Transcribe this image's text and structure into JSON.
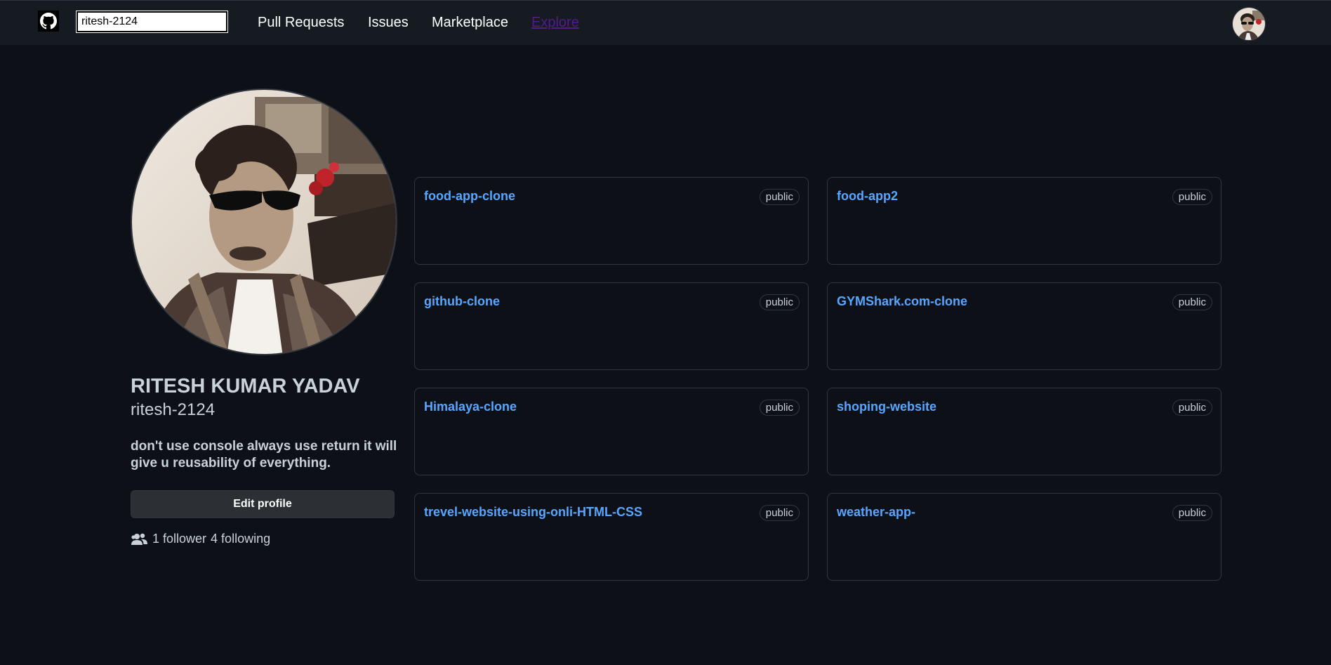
{
  "header": {
    "search_value": "ritesh-2124",
    "nav": [
      {
        "label": "Pull Requests"
      },
      {
        "label": "Issues"
      },
      {
        "label": "Marketplace"
      },
      {
        "label": "Explore"
      }
    ]
  },
  "profile": {
    "full_name": "RITESH KUMAR YADAV",
    "username": "ritesh-2124",
    "bio": "don't use console always use return it will give u reusability of everything.",
    "edit_label": "Edit profile",
    "followers_text": "1 follower",
    "following_text": "4 following"
  },
  "repos": [
    {
      "name": "food-app-clone",
      "visibility": "public"
    },
    {
      "name": "food-app2",
      "visibility": "public"
    },
    {
      "name": "github-clone",
      "visibility": "public"
    },
    {
      "name": "GYMShark.com-clone",
      "visibility": "public"
    },
    {
      "name": "Himalaya-clone",
      "visibility": "public"
    },
    {
      "name": "shoping-website",
      "visibility": "public"
    },
    {
      "name": "trevel-website-using-onli-HTML-CSS",
      "visibility": "public"
    },
    {
      "name": "weather-app-",
      "visibility": "public"
    }
  ],
  "colors": {
    "background": "#0d1117",
    "header": "#161b22",
    "border": "#30363d",
    "link": "#58a6ff",
    "visited_link": "#551a8b"
  },
  "icons": {
    "logo": "github-logo-icon",
    "people": "people-icon"
  }
}
